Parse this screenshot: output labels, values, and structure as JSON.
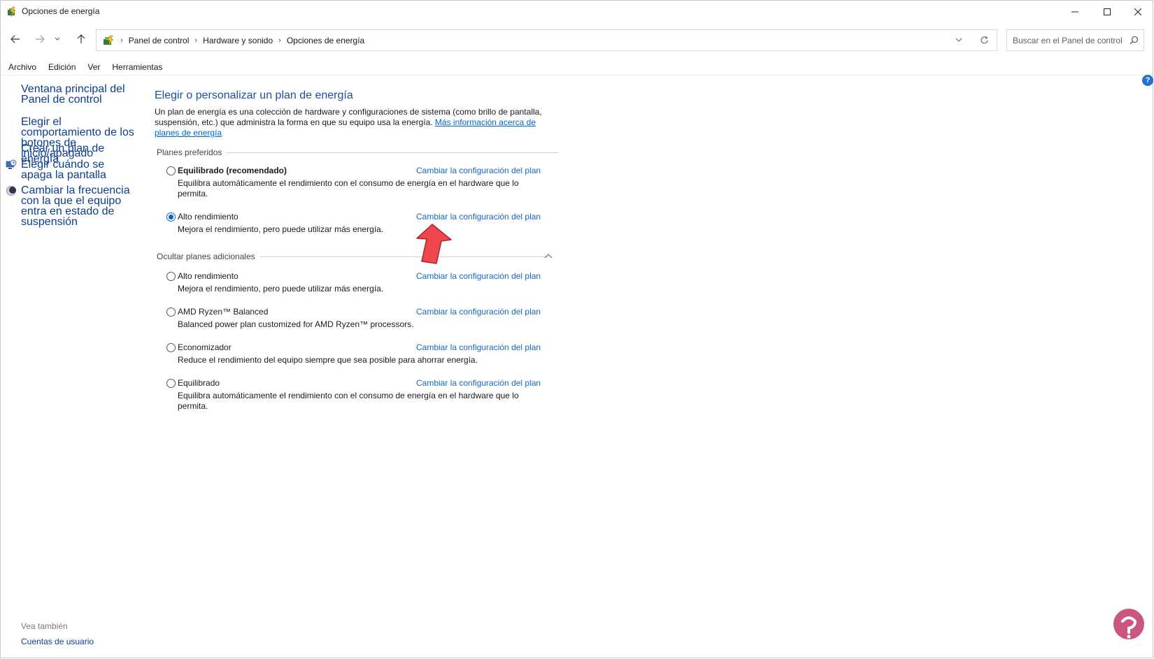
{
  "window": {
    "title": "Opciones de energía",
    "icons": {
      "app": "power-options-icon",
      "minimize": "minimize-icon",
      "maximize": "maximize-icon",
      "close": "close-icon"
    }
  },
  "nav": {
    "back": "back-arrow-icon",
    "forward": "forward-arrow-icon",
    "recent": "chevron-down-icon",
    "up": "up-arrow-icon"
  },
  "address": {
    "crumbs": [
      "Panel de control",
      "Hardware y sonido",
      "Opciones de energía"
    ],
    "dropdown_icon": "chevron-down-icon",
    "refresh_icon": "refresh-icon"
  },
  "search": {
    "placeholder": "Buscar en el Panel de control",
    "icon": "search-icon"
  },
  "menu": [
    "Archivo",
    "Edición",
    "Ver",
    "Herramientas"
  ],
  "sidebar": {
    "links": [
      {
        "label": "Ventana principal del Panel de control",
        "icon": null
      },
      {
        "label": "Elegir el comportamiento de los botones de inicio/apagado",
        "icon": null
      },
      {
        "label": "Crear un plan de energía",
        "icon": null
      },
      {
        "label": "Elegir cuándo se apaga la pantalla",
        "icon": "monitor-clock-icon"
      },
      {
        "label": "Cambiar la frecuencia con la que el equipo entra en estado de suspensión",
        "icon": "moon-icon"
      }
    ],
    "see_also_title": "Vea también",
    "see_also_links": [
      "Cuentas de usuario"
    ]
  },
  "main": {
    "title": "Elegir o personalizar un plan de energía",
    "intro_text": "Un plan de energía es una colección de hardware y configuraciones de sistema (como brillo de pantalla, suspensión, etc.) que administra la forma en que su equipo usa la energía.",
    "intro_link": "Más información acerca de planes de energía",
    "preferred_label": "Planes preferidos",
    "additional_label": "Ocultar planes adicionales",
    "change_link": "Cambiar la configuración del plan",
    "preferred_plans": [
      {
        "name": "Equilibrado (recomendado)",
        "desc": "Equilibra automáticamente el rendimiento con el consumo de energía en el hardware que lo permita.",
        "selected": false,
        "bold": true
      },
      {
        "name": "Alto rendimiento",
        "desc": "Mejora el rendimiento, pero puede utilizar más energía.",
        "selected": true,
        "bold": false
      }
    ],
    "additional_plans": [
      {
        "name": "Alto rendimiento",
        "desc": "Mejora el rendimiento, pero puede utilizar más energía.",
        "selected": false
      },
      {
        "name": "AMD Ryzen™ Balanced",
        "desc": "Balanced power plan customized for AMD Ryzen™ processors.",
        "selected": false
      },
      {
        "name": "Economizador",
        "desc": "Reduce el rendimiento del equipo siempre que sea posible para ahorrar energía.",
        "selected": false
      },
      {
        "name": "Equilibrado",
        "desc": "Equilibra automáticamente el rendimiento con el consumo de energía en el hardware que lo permita.",
        "selected": false
      }
    ]
  },
  "help": {
    "label": "?",
    "icon": "help-icon"
  },
  "colors": {
    "link": "#1767c4",
    "title": "#1c4fa0",
    "radio_selected": "#0f5ec9",
    "annotation_arrow": "#f0474e"
  }
}
